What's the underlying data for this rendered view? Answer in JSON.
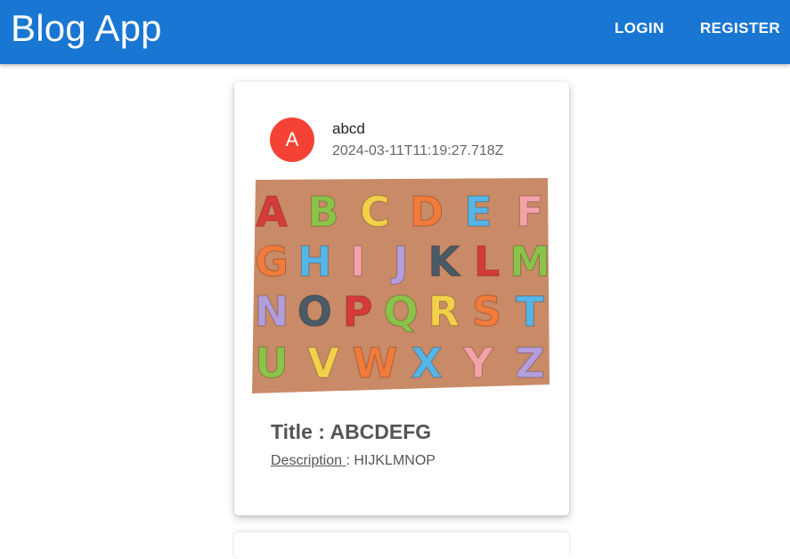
{
  "appbar": {
    "title": "Blog App",
    "login_label": "LOGIN",
    "register_label": "REGISTER",
    "color": "#1976d2"
  },
  "post": {
    "avatar_letter": "A",
    "avatar_color": "#f44336",
    "author": "abcd",
    "date": "2024-03-11T11:19:27.718Z",
    "image_rows": [
      [
        "A",
        "B",
        "C",
        "D",
        "E",
        "F"
      ],
      [
        "G",
        "H",
        "I",
        "J",
        "K",
        "L",
        "M"
      ],
      [
        "N",
        "O",
        "P",
        "Q",
        "R",
        "S",
        "T"
      ],
      [
        "U",
        "V",
        "W",
        "X",
        "Y",
        "Z"
      ]
    ],
    "title_label": "Title : ",
    "title": "ABCDEFG",
    "description_label": "Description ",
    "description_sep": ": ",
    "description": "HIJKLMNOP"
  }
}
